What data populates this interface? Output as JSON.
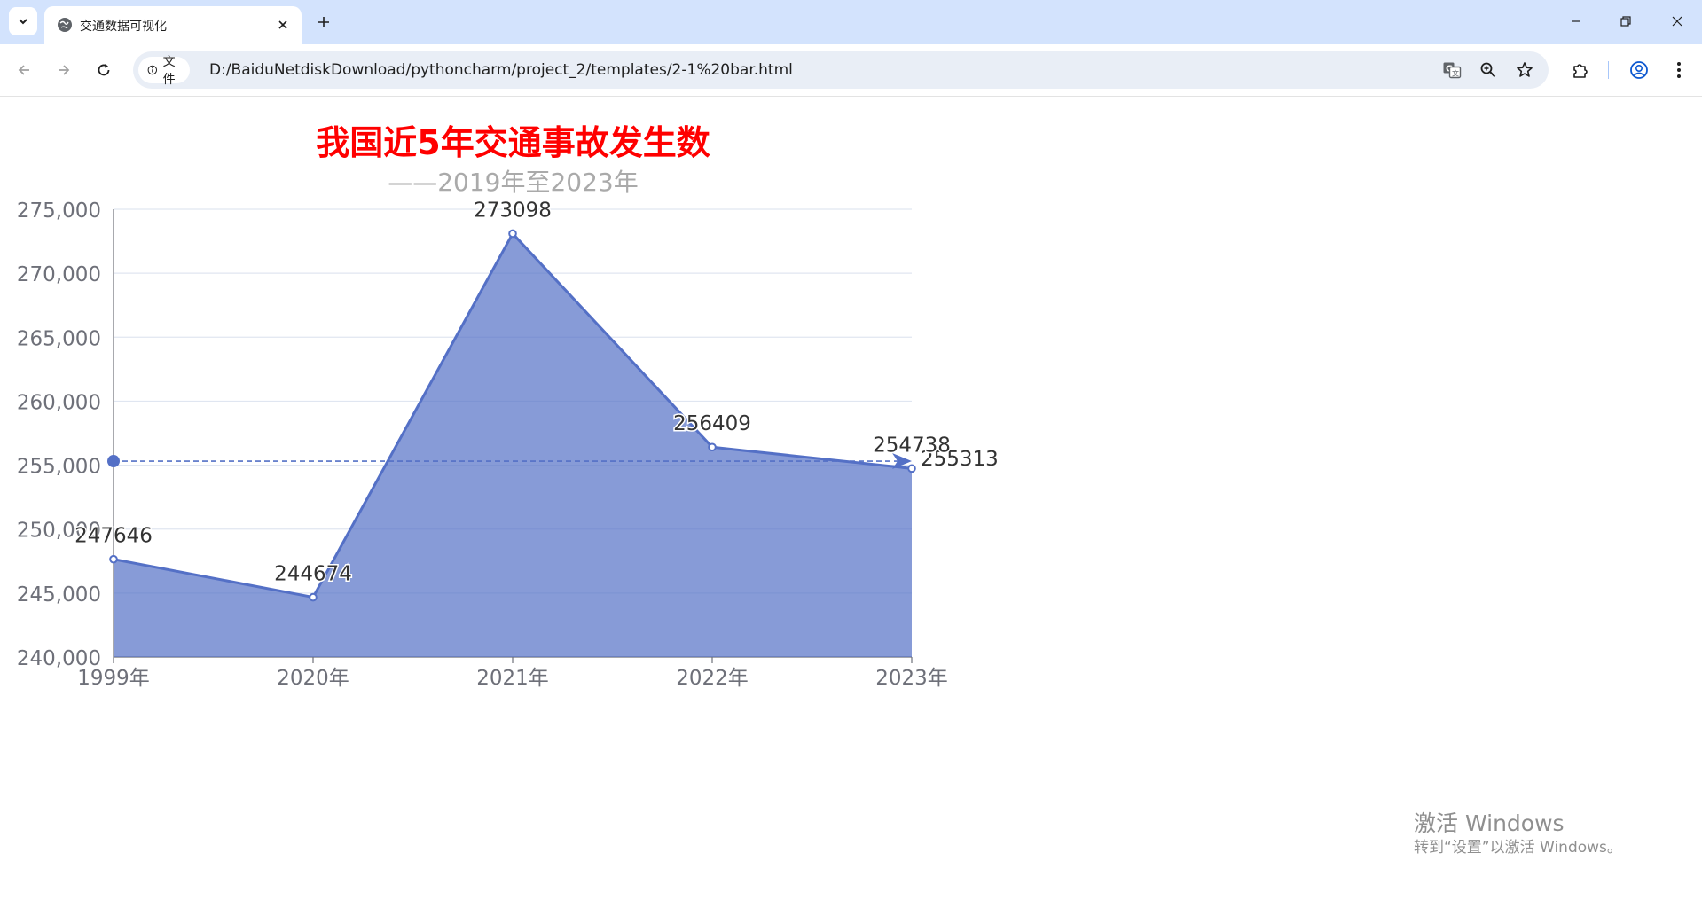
{
  "browser": {
    "tab": {
      "title": "交通数据可视化"
    },
    "address": {
      "site_label": "文件",
      "url": "D:/BaiduNetdiskDownload/pythoncharm/project_2/templates/2-1%20bar.html"
    },
    "icons": {
      "tab_search": "chevron-down-icon",
      "favicon": "globe-icon",
      "close": "close-icon",
      "new_tab": "plus-icon",
      "back": "arrow-left-icon",
      "forward": "arrow-right-icon",
      "reload": "reload-icon",
      "info": "info-icon",
      "translate": "translate-icon",
      "zoom": "zoom-icon",
      "bookmark": "star-icon",
      "extensions": "puzzle-icon",
      "profile": "profile-icon",
      "menu": "kebab-menu-icon"
    }
  },
  "chart_data": {
    "type": "area",
    "title": "我国近5年交通事故发生数",
    "subtitle": "——2019年至2023年",
    "categories": [
      "1999年",
      "2020年",
      "2021年",
      "2022年",
      "2023年"
    ],
    "series": [
      {
        "values": [
          247646,
          244674,
          273098,
          256409,
          254738
        ],
        "color": "#5470c6",
        "fill_color": "#5470c6",
        "markline": {
          "type": "average",
          "value": 255313
        }
      }
    ],
    "xlabel": "",
    "ylabel": "",
    "ylim": [
      240000,
      275000
    ],
    "yticks": [
      "240,000",
      "245,000",
      "250,000",
      "255,000",
      "260,000",
      "265,000",
      "270,000",
      "275,000"
    ],
    "grid": true,
    "colors": {
      "title": "#ff0000",
      "subtitle": "#aaaaaa",
      "axis_text": "#6e7079",
      "grid": "#e0e6f1"
    }
  },
  "watermark": {
    "line1": "激活 Windows",
    "line2": "转到“设置”以激活 Windows。"
  }
}
